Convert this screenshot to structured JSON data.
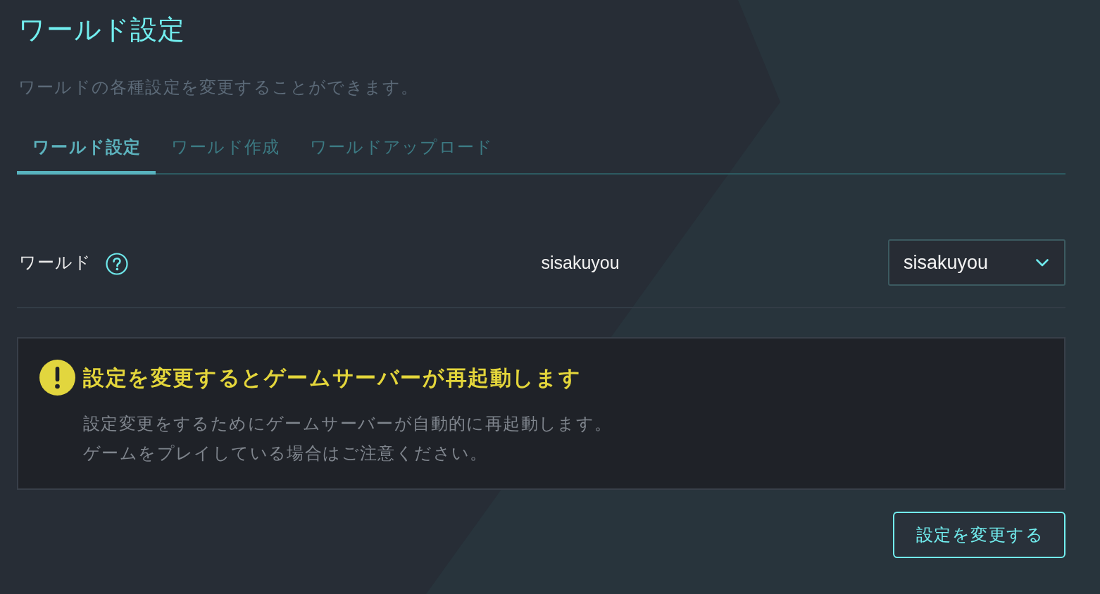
{
  "page": {
    "title": "ワールド設定",
    "description": "ワールドの各種設定を変更することができます。"
  },
  "tabs": [
    {
      "label": "ワールド設定",
      "selected": true
    },
    {
      "label": "ワールド作成",
      "selected": false
    },
    {
      "label": "ワールドアップロード",
      "selected": false
    }
  ],
  "settings": [
    {
      "label": "ワールド",
      "current_value": "sisakuyou",
      "select": {
        "value": "sisakuyou"
      }
    }
  ],
  "warning": {
    "title": "設定を変更するとゲームサーバーが再起動します",
    "lines": [
      "設定変更をするためにゲームサーバーが自動的に再起動します。",
      "ゲームをプレイしている場合はご注意ください。"
    ]
  },
  "buttons": [
    {
      "label": "設定を変更する"
    }
  ]
}
